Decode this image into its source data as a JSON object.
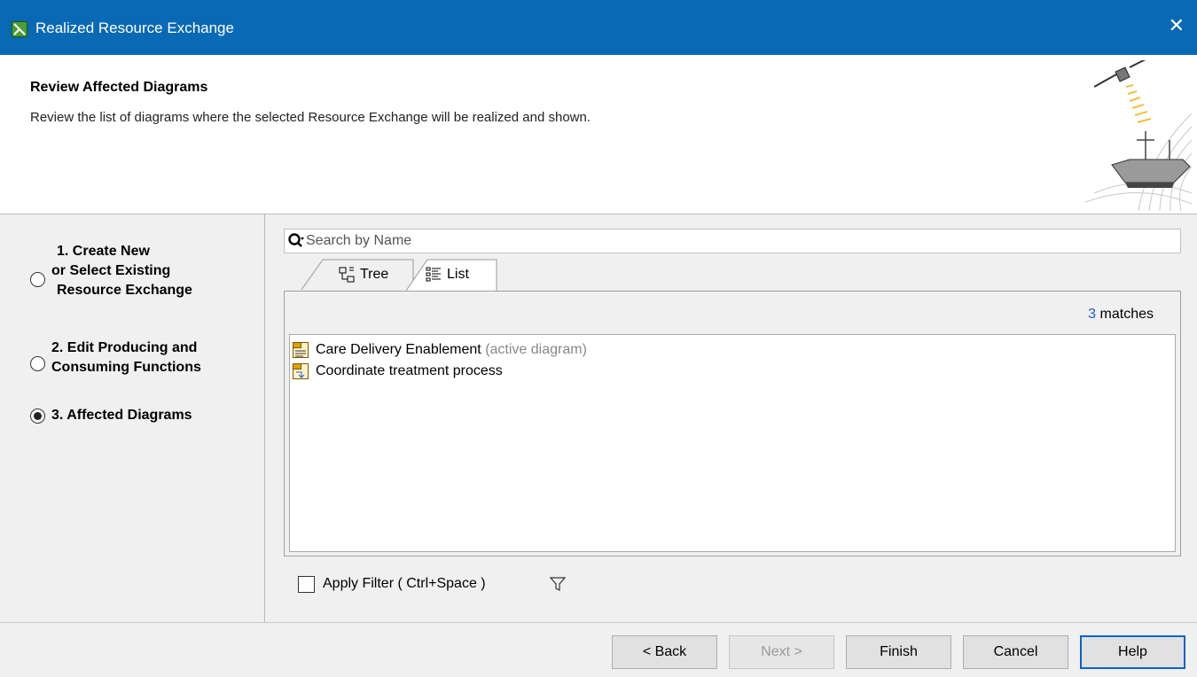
{
  "window": {
    "title": "Realized Resource Exchange",
    "app_icon": "magicdraw-app-icon",
    "close_glyph": "✕"
  },
  "header": {
    "title": "Review Affected Diagrams",
    "description": "Review the list of diagrams where the selected Resource Exchange will be realized and shown."
  },
  "steps": [
    {
      "lines": [
        "1. Create New",
        "or Select Existing",
        "Resource Exchange"
      ],
      "selected": false
    },
    {
      "lines": [
        "2. Edit Producing and",
        "Consuming Functions"
      ],
      "selected": false
    },
    {
      "lines": [
        "3. Affected Diagrams"
      ],
      "selected": true
    }
  ],
  "search": {
    "placeholder": "Search by Name",
    "value": ""
  },
  "tabs": [
    {
      "label": "Tree",
      "icon": "tree-icon",
      "active": false
    },
    {
      "label": "List",
      "icon": "list-icon",
      "active": true
    }
  ],
  "matches": {
    "count": "3",
    "suffix": " matches"
  },
  "items": [
    {
      "name": "Care Delivery Enablement",
      "hint": " (active diagram)",
      "icon": "resource-flow-diagram-icon"
    },
    {
      "name": "Coordinate treatment process",
      "hint": "",
      "icon": "process-flow-diagram-icon"
    }
  ],
  "filter": {
    "label": "Apply Filter ( Ctrl+Space )",
    "checked": false,
    "icon": "funnel-icon"
  },
  "buttons": {
    "back": "< Back",
    "next": "Next >",
    "finish": "Finish",
    "cancel": "Cancel",
    "help": "Help"
  },
  "colors": {
    "titlebar": "#0969b4",
    "link_count": "#1c5ad6",
    "default_button_border": "#0a64c8"
  }
}
